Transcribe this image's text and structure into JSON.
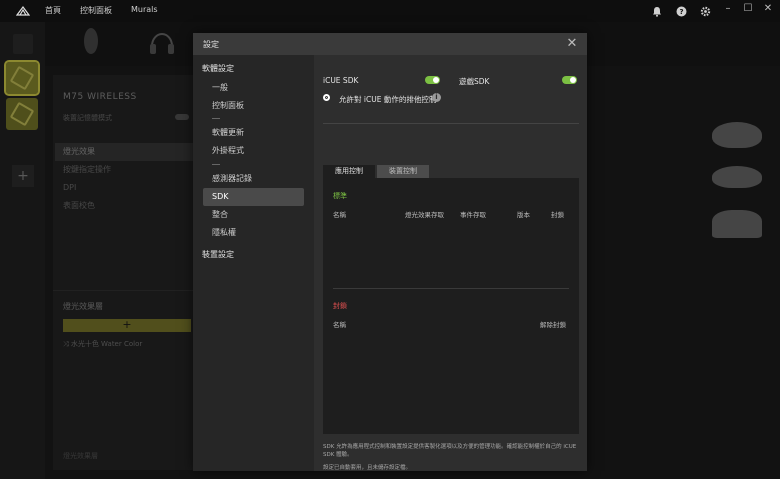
{
  "titlebar": {
    "nav": [
      "首頁",
      "控制面板",
      "Murals"
    ],
    "icons": [
      "bell-icon",
      "help-icon",
      "gear-icon"
    ],
    "window_controls": [
      "–",
      "☐",
      "✕"
    ]
  },
  "background": {
    "device_name": "M75 WIRELESS",
    "device_mode": "裝置記憶體模式",
    "menu": [
      "燈光效果",
      "按鍵指定操作",
      "DPI",
      "表面校色"
    ],
    "lighting_layers_title": "燈光效果層",
    "add_symbol": "+",
    "layer_item": "⤨  水光十色  Water Color",
    "bottom_label": "燈光效果層"
  },
  "modal": {
    "title": "設定",
    "close": "✕",
    "menu": {
      "software_settings": "軟體設定",
      "items": [
        "一般",
        "控制面板",
        "軟體更新",
        "外掛程式",
        "感測器記錄",
        "SDK",
        "整合",
        "隱私權"
      ],
      "device_settings": "裝置設定"
    },
    "sdk": {
      "icue_sdk_label": "iCUE SDK",
      "icue_sdk_on": true,
      "game_sdk_label": "遊戲SDK",
      "game_sdk_on": true,
      "exclusive_label": "允許對 iCUE 動作的排他控制",
      "tabs": [
        "應用控制",
        "裝置控制"
      ],
      "standard_label": "標準",
      "standard_color": "#7cc043",
      "columns": [
        "名稱",
        "燈光效果存取",
        "事件存取",
        "版本",
        "封鎖"
      ],
      "blocked_label": "封鎖",
      "blocked_color": "#e05050",
      "blocked_columns": [
        "名稱",
        "解除封鎖"
      ],
      "footer1": "SDK 允許為應用程式控制和裝置設定提供客製化選項以及方便的管理功能。確認能控制權於自己的 iCUE SDK 體驗。",
      "footer2": "設定已自動套用，且未儲存設定檔。"
    }
  }
}
